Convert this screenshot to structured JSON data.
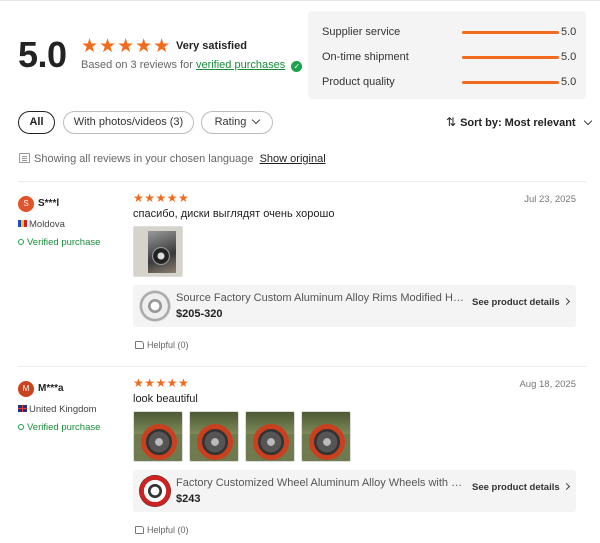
{
  "summary": {
    "score": "5.0",
    "stars": "★★★★★",
    "verdict": "Very satisfied",
    "based_on": "Based on 3 reviews for",
    "verified_link": "verified purchases",
    "verified_badge": "✓"
  },
  "metrics": [
    {
      "label": "Supplier service",
      "value": "5.0",
      "fraction": 1.0
    },
    {
      "label": "On-time shipment",
      "value": "5.0",
      "fraction": 1.0
    },
    {
      "label": "Product quality",
      "value": "5.0",
      "fraction": 1.0
    }
  ],
  "filters": {
    "all": "All",
    "with_media": "With photos/videos (3)",
    "rating": "Rating"
  },
  "sort": {
    "icon": "⇅",
    "label": "Sort by: Most relevant"
  },
  "language_note": {
    "text": "Showing all reviews in your chosen language",
    "link": "Show original"
  },
  "reviews": [
    {
      "avatar_letter": "S",
      "avatar_color": "#e0532b",
      "name": "S***l",
      "country": "Moldova",
      "verified": "Verified purchase",
      "stars": "★★★★★",
      "date": "Jul 23, 2025",
      "text": "спасибо, диски выглядят очень хорошо",
      "product_title": "Source Factory Custom Aluminum Alloy Rims Modified Hub...",
      "product_price": "$205-320",
      "see_details": "See product details",
      "helpful": "Helpful (0)"
    },
    {
      "avatar_letter": "M",
      "avatar_color": "#c9441e",
      "name": "M***a",
      "country": "United Kingdom",
      "verified": "Verified purchase",
      "stars": "★★★★★",
      "date": "Aug 18, 2025",
      "text": "look beautiful",
      "product_title": "Factory Customized Wheel Aluminum Alloy Wheels with Hu...",
      "product_price": "$243",
      "see_details": "See product details",
      "helpful": "Helpful (0)"
    }
  ],
  "colors": {
    "accent": "#f26b1d",
    "verified_green": "#1a8a3a"
  }
}
